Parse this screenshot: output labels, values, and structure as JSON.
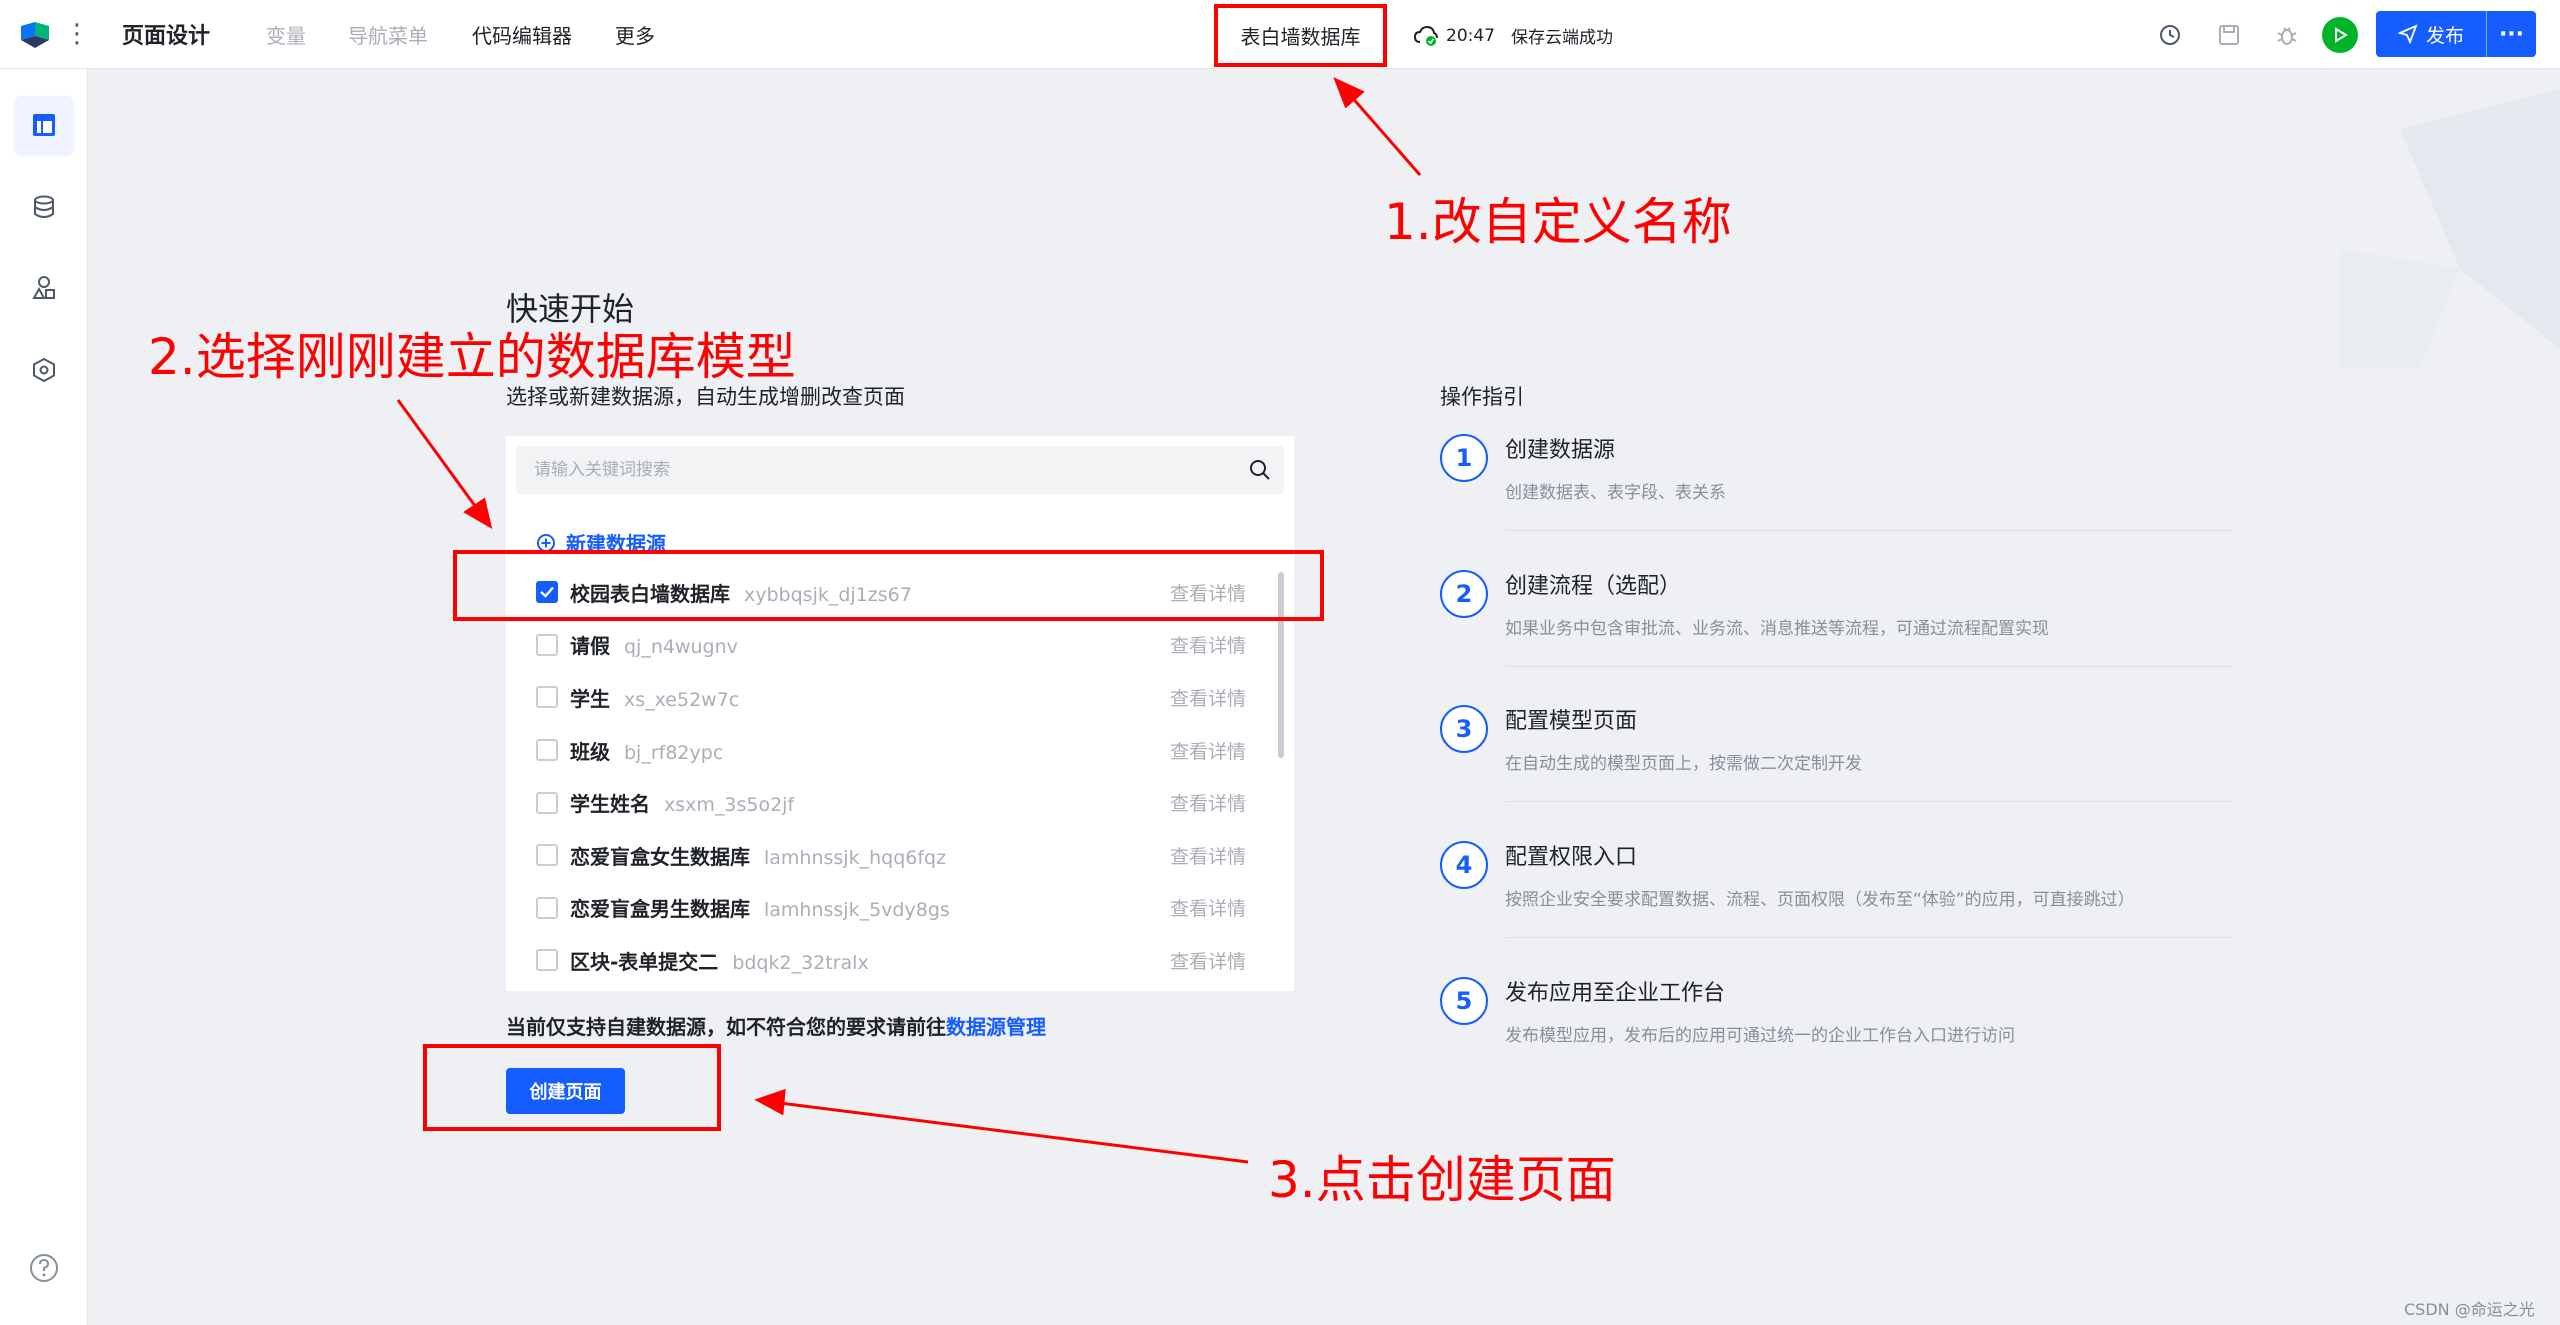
{
  "topbar": {
    "title": "页面设计",
    "nav": [
      "变量",
      "导航菜单",
      "代码编辑器",
      "更多"
    ],
    "app_name": "表白墙数据库",
    "save_time": "20:47",
    "save_text": "保存云端成功",
    "publish_label": "发布",
    "more_label": "···"
  },
  "main": {
    "title": "快速开始",
    "subtitle": "选择或新建数据源，自动生成增删改查页面",
    "search_placeholder": "请输入关键词搜索",
    "new_datasource": "新建数据源",
    "detail_label": "查看详情",
    "datasources": [
      {
        "name": "校园表白墙数据库",
        "code": "xybbqsjk_dj1zs67",
        "checked": true
      },
      {
        "name": "请假",
        "code": "qj_n4wugnv",
        "checked": false
      },
      {
        "name": "学生",
        "code": "xs_xe52w7c",
        "checked": false
      },
      {
        "name": "班级",
        "code": "bj_rf82ypc",
        "checked": false
      },
      {
        "name": "学生姓名",
        "code": "xsxm_3s5o2jf",
        "checked": false
      },
      {
        "name": "恋爱盲盒女生数据库",
        "code": "lamhnssjk_hqq6fqz",
        "checked": false
      },
      {
        "name": "恋爱盲盒男生数据库",
        "code": "lamhnssjk_5vdy8gs",
        "checked": false
      },
      {
        "name": "区块-表单提交二",
        "code": "bdqk2_32tralx",
        "checked": false
      }
    ],
    "notice_prefix": "当前仅支持自建数据源，如不符合您的要求请前往",
    "notice_link": "数据源管理",
    "create_button": "创建页面"
  },
  "guide": {
    "title": "操作指引",
    "steps": [
      {
        "num": "1",
        "title": "创建数据源",
        "desc": "创建数据表、表字段、表关系"
      },
      {
        "num": "2",
        "title": "创建流程（选配）",
        "desc": "如果业务中包含审批流、业务流、消息推送等流程，可通过流程配置实现"
      },
      {
        "num": "3",
        "title": "配置模型页面",
        "desc": "在自动生成的模型页面上，按需做二次定制开发"
      },
      {
        "num": "4",
        "title": "配置权限入口",
        "desc": "按照企业安全要求配置数据、流程、页面权限（发布至“体验”的应用，可直接跳过）"
      },
      {
        "num": "5",
        "title": "发布应用至企业工作台",
        "desc": "发布模型应用，发布后的应用可通过统一的企业工作台入口进行访问"
      }
    ]
  },
  "annotations": {
    "a1": "1.改自定义名称",
    "a2": "2.选择刚刚建立的数据库模型",
    "a3": "3.点击创建页面"
  },
  "watermark": "CSDN @命运之光",
  "colors": {
    "accent": "#165dff",
    "annotation": "#ff0000",
    "success": "#00b42a"
  },
  "icons": [
    "history-icon",
    "save-icon",
    "bug-icon",
    "play-icon",
    "send-icon",
    "page-icon",
    "database-icon",
    "components-icon",
    "settings-icon",
    "help-icon",
    "search-icon",
    "plus-circle-icon",
    "cloud-check-icon"
  ]
}
